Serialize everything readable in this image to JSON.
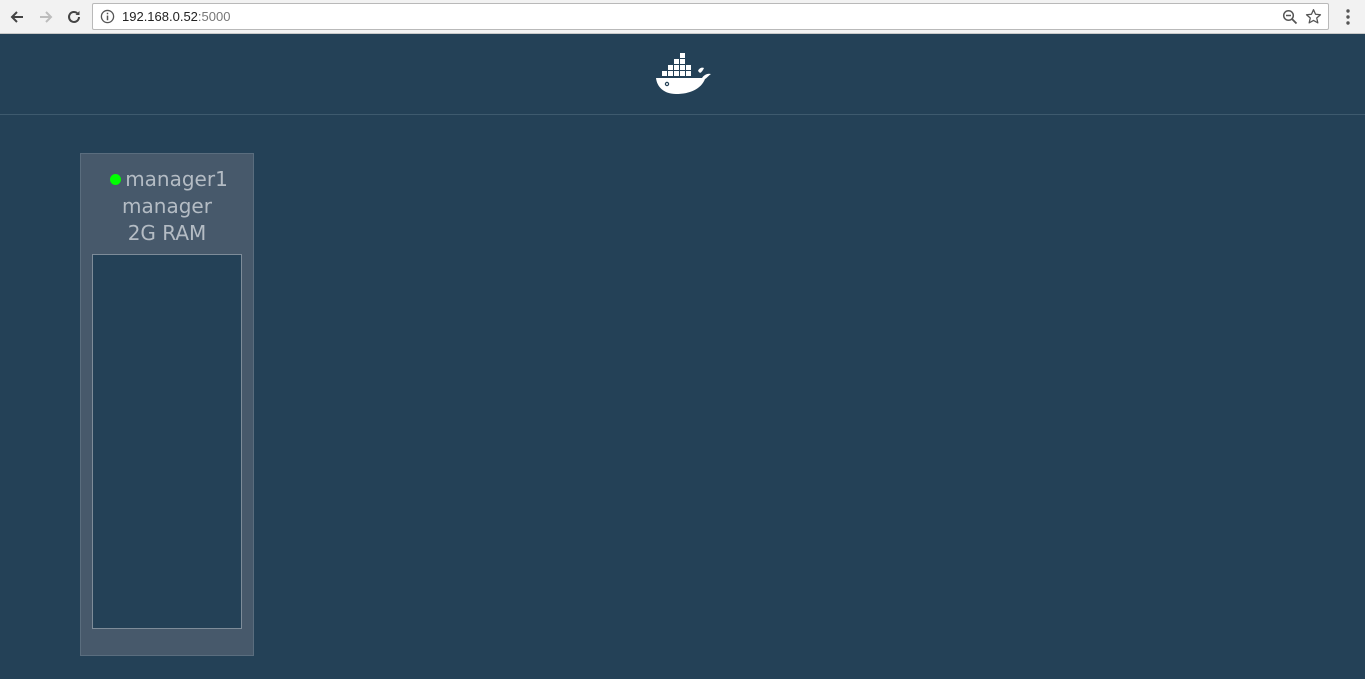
{
  "browser": {
    "url_host": "192.168.0.52",
    "url_port": ":5000",
    "icons": {
      "back": "back-arrow-icon",
      "forward": "forward-arrow-icon",
      "reload": "reload-icon",
      "info": "info-icon",
      "zoom": "zoom-icon",
      "bookmark": "star-icon",
      "menu": "kebab-menu-icon"
    }
  },
  "header": {
    "logo": "docker-whale-logo"
  },
  "nodes": [
    {
      "name": "manager1",
      "role": "manager",
      "ram": "2G RAM",
      "status": "up",
      "status_color": "#00ff00"
    }
  ],
  "colors": {
    "background": "#244157",
    "card": "#47596b",
    "status_up": "#00ff00"
  }
}
